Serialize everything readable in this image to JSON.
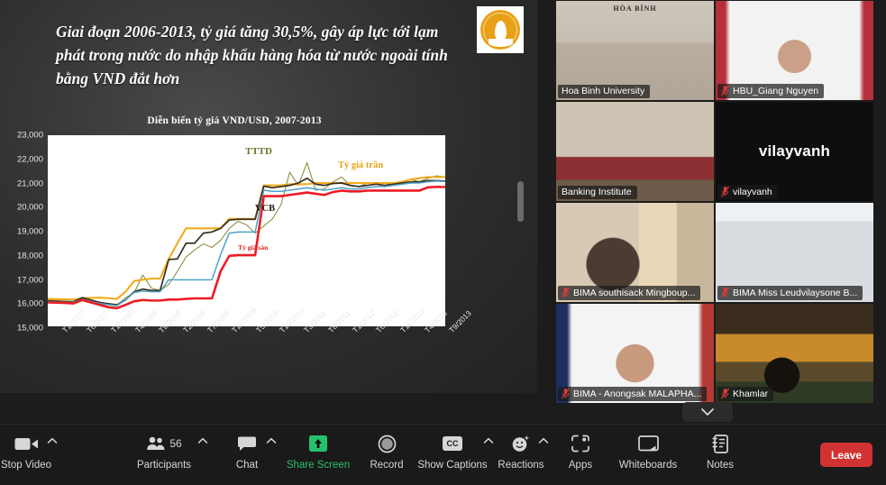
{
  "slide": {
    "title": "Giai đoạn 2006-2013, tỷ giá tăng 30,5%, gây áp lực tới lạm phát trong nước do nhập khẩu hàng hóa từ nước ngoài tính bằng VND đắt hơn",
    "logo_name": "banking-academy-logo",
    "logo_color": "#e8a117"
  },
  "chart_data": {
    "type": "line",
    "title": "Diễn biến tỷ giá VND/USD, 2007-2013",
    "xlabel": "",
    "ylabel": "",
    "ylim": [
      15000,
      23000
    ],
    "ytick_step": 1000,
    "yticks": [
      "23,000",
      "22,000",
      "21,000",
      "20,000",
      "19,000",
      "18,000",
      "17,000",
      "16,000",
      "15,000"
    ],
    "grid": false,
    "legend_position": "inline-annotations",
    "categories": [
      "T1/2007",
      "T6/2007",
      "T11/2007",
      "T4/2008",
      "T9/2008",
      "T2/2009",
      "T7/2009",
      "T12/2009",
      "T5/2010",
      "T10/2010",
      "T3/2011",
      "T8/2011",
      "T1/2012",
      "T6/2012",
      "T11/2012",
      "T4/2013",
      "T9/2013"
    ],
    "annotations": [
      {
        "text": "TTTD",
        "color": "#6d7328"
      },
      {
        "text": "Tỷ giá trần",
        "color": "#e8a317"
      },
      {
        "text": "VCB",
        "color": "#221c12"
      },
      {
        "text": "Tỷ giá sàn",
        "color": "#e02020"
      }
    ],
    "series": [
      {
        "name": "TTTD",
        "color": "#8a9140",
        "values": [
          16100,
          16080,
          16050,
          16000,
          16150,
          16030,
          15950,
          15900,
          15850,
          16200,
          16400,
          17150,
          16600,
          16500,
          16750,
          17300,
          17900,
          18200,
          18450,
          18300,
          18600,
          19100,
          19400,
          19250,
          18900,
          19200,
          19500,
          20100,
          21450,
          20900,
          21850,
          20700,
          20750,
          21050,
          21250,
          20900,
          20850,
          21000,
          20950,
          20900,
          21000,
          21050,
          21150,
          21050,
          21200,
          21300,
          21250
        ]
      },
      {
        "name": "Tỷ giá trần",
        "color": "#f0ab1b",
        "values": [
          16150,
          16140,
          16130,
          16120,
          16180,
          16190,
          16200,
          16180,
          16150,
          16450,
          16900,
          16950,
          17000,
          17000,
          17820,
          18480,
          19100,
          19100,
          19100,
          19100,
          19100,
          19500,
          19500,
          19500,
          19500,
          20900,
          20900,
          20900,
          20950,
          20950,
          20950,
          21000,
          21000,
          21000,
          21000,
          21000,
          21000,
          21000,
          21000,
          21000,
          21000,
          21050,
          21150,
          21200,
          21250,
          21250,
          21250
        ]
      },
      {
        "name": "VCB",
        "color": "#3a2f1e",
        "values": [
          16060,
          16050,
          16040,
          16030,
          16200,
          16100,
          16000,
          15950,
          15900,
          16100,
          16450,
          16560,
          16500,
          16500,
          17800,
          17820,
          18480,
          18480,
          18900,
          18950,
          19100,
          19450,
          19480,
          19480,
          19480,
          20870,
          20800,
          20850,
          20900,
          21000,
          21200,
          20950,
          20900,
          20980,
          21000,
          20900,
          20850,
          20900,
          20950,
          20900,
          20950,
          21000,
          21050,
          21050,
          21100,
          21100,
          21080
        ]
      },
      {
        "name": "Tỷ giá sàn",
        "color": "#4ea3c8",
        "values": [
          16030,
          16020,
          16010,
          16000,
          16130,
          16040,
          15960,
          15910,
          15870,
          16100,
          16420,
          16480,
          16450,
          16450,
          16950,
          16950,
          16950,
          16950,
          16950,
          16950,
          18000,
          18900,
          18950,
          18950,
          18950,
          20700,
          20650,
          20650,
          20700,
          20750,
          20800,
          20750,
          20700,
          20750,
          20800,
          20750,
          20750,
          20800,
          20850,
          20850,
          20900,
          20950,
          21000,
          21000,
          21050,
          21080,
          21060
        ]
      },
      {
        "name": "Tỷ giá sàn (floor)",
        "color": "#ed1c24",
        "values": [
          16000,
          15990,
          15980,
          15960,
          16100,
          16000,
          15900,
          15800,
          15760,
          15900,
          16050,
          16100,
          16080,
          16080,
          16120,
          16120,
          16150,
          16170,
          16170,
          16170,
          17300,
          17950,
          17980,
          17980,
          17980,
          20450,
          20450,
          20450,
          20500,
          20550,
          20600,
          20550,
          20500,
          20620,
          20680,
          20650,
          20650,
          20680,
          20680,
          20680,
          20680,
          20680,
          20680,
          20680,
          20820,
          20840,
          20830
        ]
      }
    ]
  },
  "tiles": [
    {
      "name": "Hoa Binh University",
      "muted": false,
      "active": true,
      "scene": "scene-hoabinh",
      "avatar_text": "",
      "slide_text": "HÒA BÌNH"
    },
    {
      "name": "HBU_Giang Nguyen",
      "muted": true,
      "active": false,
      "scene": "scene-hbu",
      "avatar_text": ""
    },
    {
      "name": "Banking Institute",
      "muted": false,
      "active": false,
      "scene": "scene-banking",
      "avatar_text": ""
    },
    {
      "name": "vilayvanh",
      "muted": true,
      "active": false,
      "scene": "scene-vilayvanh",
      "avatar_text": "vilayvanh"
    },
    {
      "name": "BIMA southisack Mingboup...",
      "muted": true,
      "active": false,
      "scene": "scene-southisack",
      "avatar_text": ""
    },
    {
      "name": "BIMA Miss Leudvilaysone B...",
      "muted": true,
      "active": false,
      "scene": "scene-leud",
      "avatar_text": ""
    },
    {
      "name": "BIMA - Anongsak MALAPHA...",
      "muted": true,
      "active": false,
      "scene": "scene-anongsak",
      "avatar_text": ""
    },
    {
      "name": "Khamlar",
      "muted": true,
      "active": false,
      "scene": "scene-khamlar",
      "avatar_text": ""
    }
  ],
  "toolbar": {
    "stop_video": "Stop Video",
    "participants": "Participants",
    "participants_count": "56",
    "chat": "Chat",
    "share_screen": "Share Screen",
    "record": "Record",
    "show_captions": "Show Captions",
    "cc_badge": "CC",
    "reactions": "Reactions",
    "apps": "Apps",
    "whiteboards": "Whiteboards",
    "notes": "Notes",
    "leave": "Leave",
    "share_screen_color": "#25c16f",
    "leave_color": "#d13232"
  }
}
